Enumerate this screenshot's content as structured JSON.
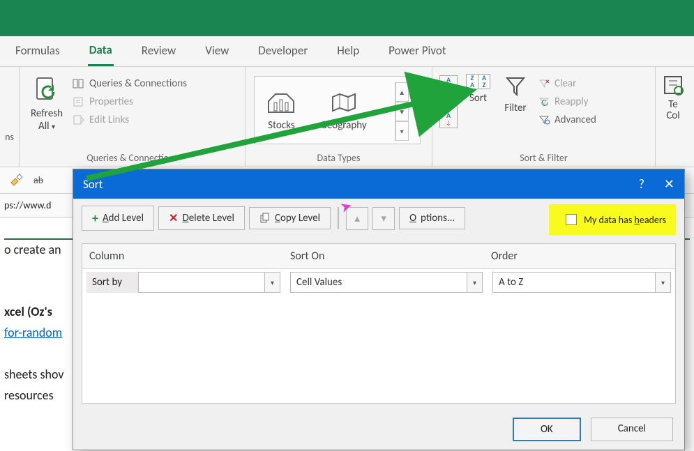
{
  "tabs": {
    "formulas": "Formulas",
    "data": "Data",
    "review": "Review",
    "view": "View",
    "developer": "Developer",
    "help": "Help",
    "powerpivot": "Power Pivot"
  },
  "ribbon": {
    "refresh": "Refresh\nAll",
    "queries_conn": "Queries & Connections",
    "properties": "Properties",
    "edit_links": "Edit Links",
    "group_queries": "Queries & Connections",
    "stocks": "Stocks",
    "geography": "Geography",
    "group_datatypes": "Data Types",
    "sort": "Sort",
    "filter": "Filter",
    "clear": "Clear",
    "reapply": "Reapply",
    "advanced": "Advanced",
    "group_sortfilter": "Sort & Filter",
    "text_to_cols1": "Te",
    "text_to_cols2": "Col"
  },
  "sheet": {
    "formula_fragment": "ps://www.d",
    "row1": "o create an",
    "row2a": "xcel (Oz's ",
    "row2b": "for-random",
    "row3": "sheets shov",
    "row4": " resources"
  },
  "dialog": {
    "title": "Sort",
    "add_level": "Add Level",
    "delete_level": "Delete Level",
    "copy_level": "Copy Level",
    "options": "Options...",
    "headers_label": "My data has headers",
    "col_header": "Column",
    "sorton_header": "Sort On",
    "order_header": "Order",
    "sortby_label": "Sort by",
    "sorton_value": "Cell Values",
    "order_value": "A to Z",
    "ok": "OK",
    "cancel": "Cancel"
  }
}
